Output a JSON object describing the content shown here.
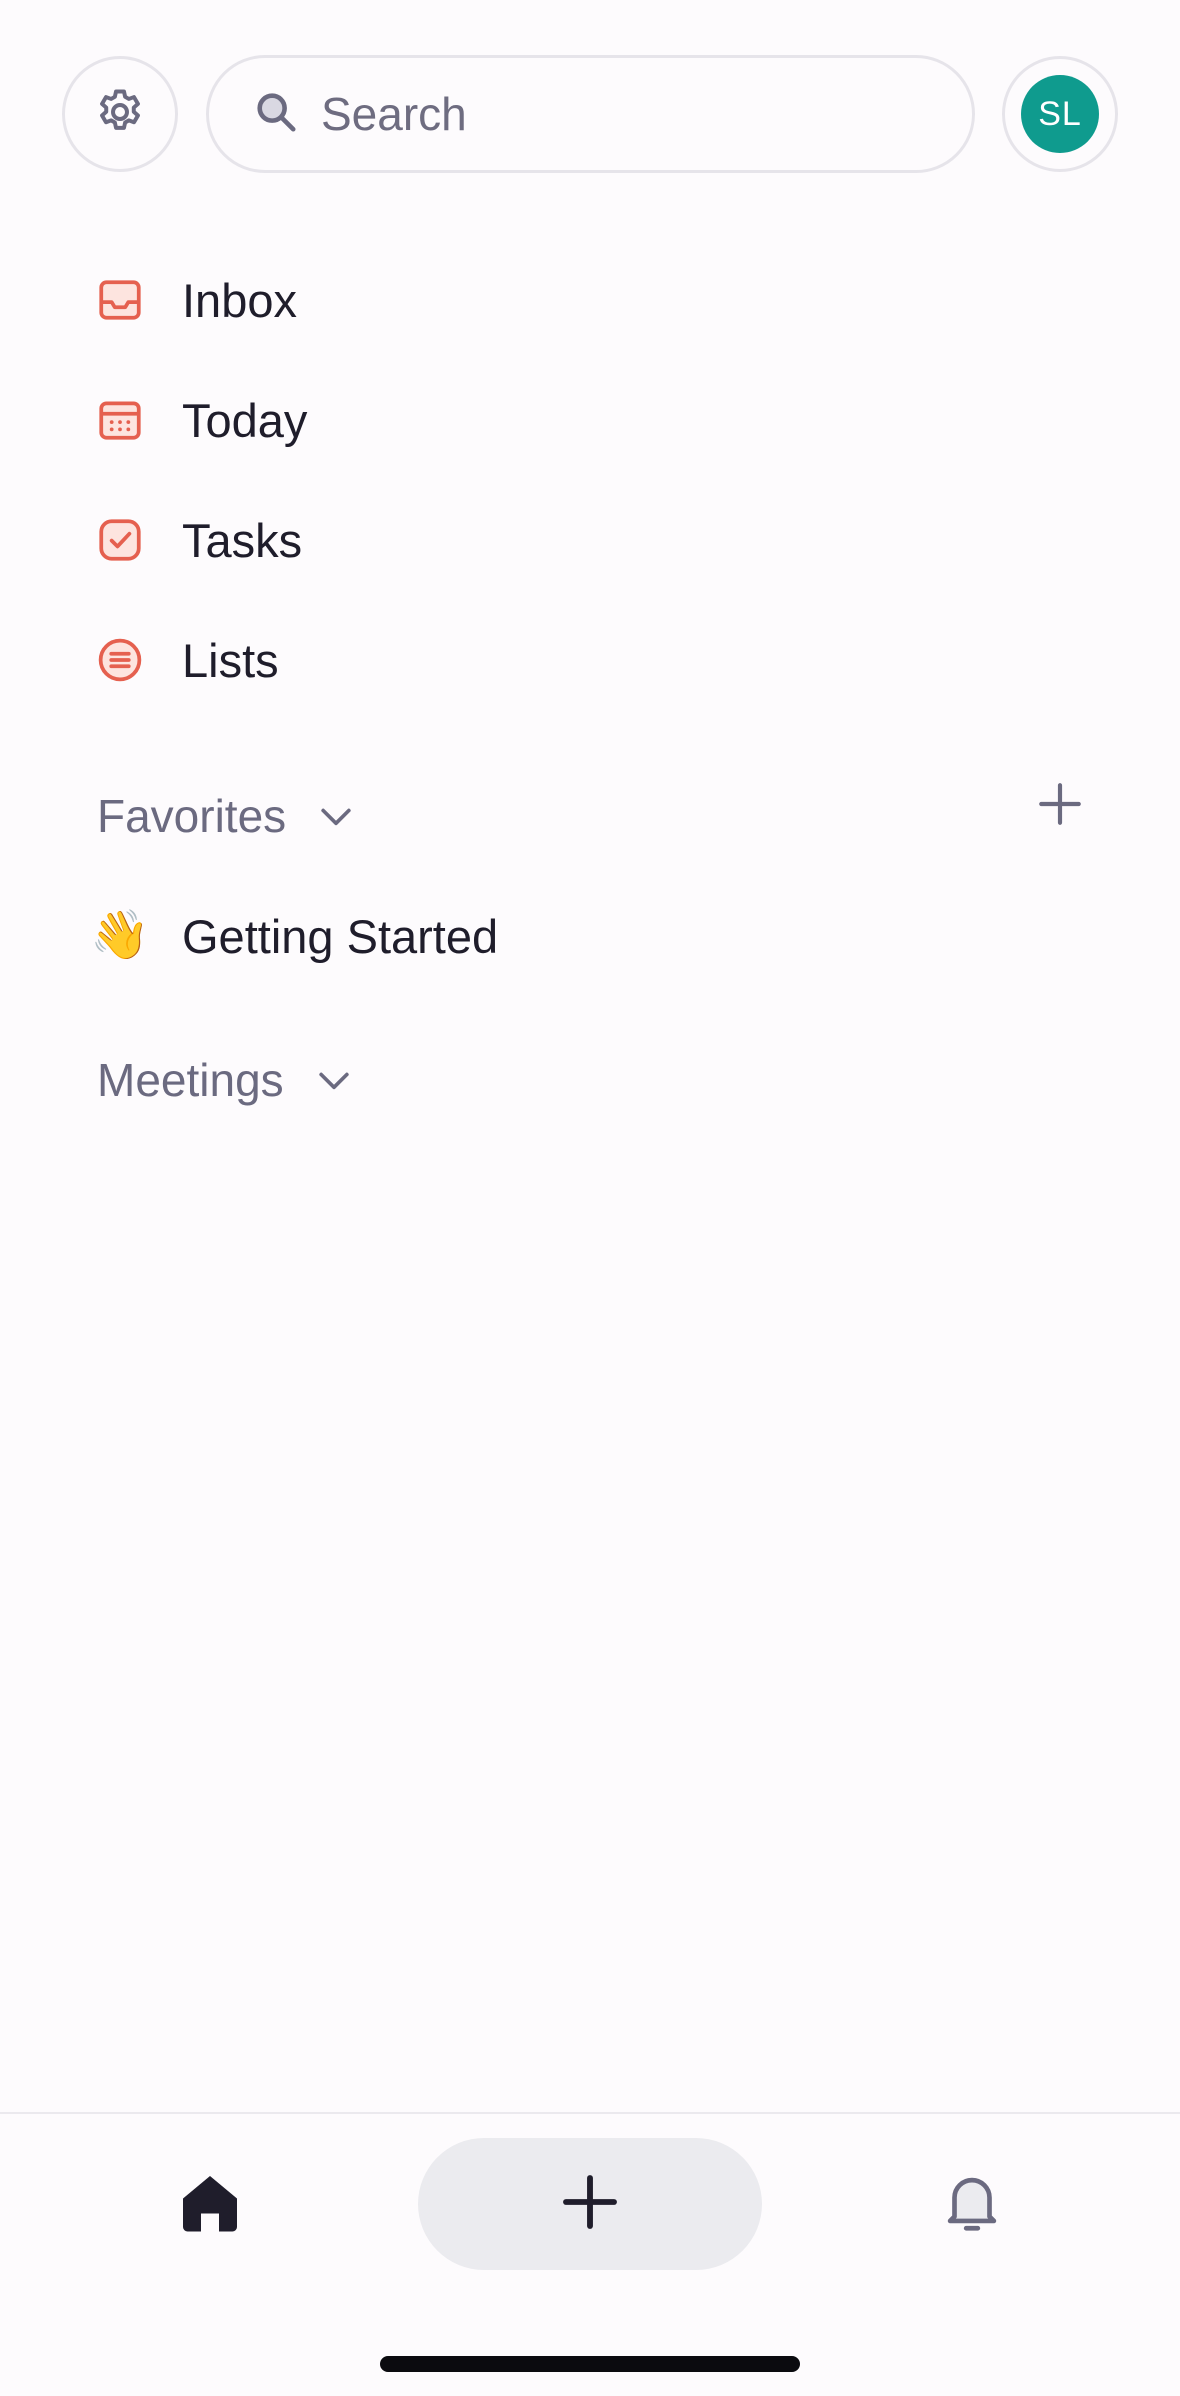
{
  "header": {
    "settings_icon": "gear-icon",
    "search": {
      "placeholder": "Search",
      "value": "",
      "icon": "search-icon"
    },
    "avatar": {
      "initials": "SL",
      "color": "#0f9b8e"
    }
  },
  "nav": {
    "items": [
      {
        "label": "Inbox",
        "icon": "inbox-icon"
      },
      {
        "label": "Today",
        "icon": "calendar-icon"
      },
      {
        "label": "Tasks",
        "icon": "checkbox-icon"
      },
      {
        "label": "Lists",
        "icon": "list-icon"
      }
    ],
    "accent_color": "#e5604f"
  },
  "favorites": {
    "title": "Favorites",
    "add_icon": "plus-icon",
    "items": [
      {
        "emoji": "👋",
        "label": "Getting Started"
      }
    ]
  },
  "meetings": {
    "title": "Meetings"
  },
  "tabbar": {
    "home_icon": "home-icon",
    "add_icon": "plus-icon",
    "notifications_icon": "bell-icon"
  },
  "colors": {
    "background": "#fdfbfd",
    "text": "#1f1d2b",
    "muted": "#6b6a80"
  }
}
